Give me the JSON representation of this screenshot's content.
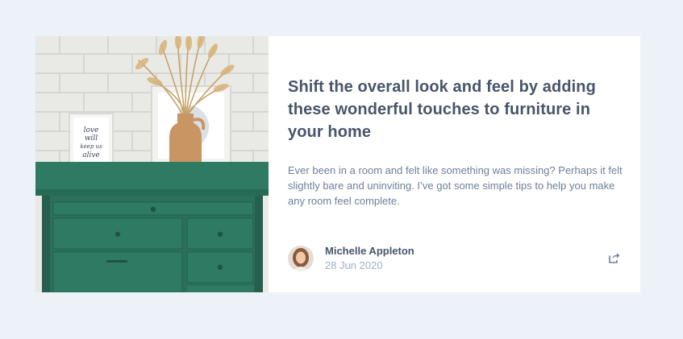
{
  "article": {
    "title": "Shift the overall look and feel by adding these wonderful touches to furniture in your home",
    "excerpt": "Ever been in a room and felt like something was missing? Perhaps it felt slightly bare and uninviting. I’ve got some simple tips to help you make any room feel complete.",
    "image_icon": "drawers-photo"
  },
  "author": {
    "name": "Michelle Appleton",
    "date": "28 Jun 2020",
    "avatar_icon": "avatar-photo"
  },
  "share": {
    "icon": "share-icon"
  },
  "poster_text": {
    "line1": "love",
    "line2": "will",
    "line3": "keep us",
    "line4": "alive"
  },
  "colors": {
    "background": "#ecf2f8",
    "card": "#ffffff",
    "heading": "#48556a",
    "body_text": "#6e8098",
    "muted": "#9eafc2",
    "drawer_green": "#2e7a63"
  }
}
